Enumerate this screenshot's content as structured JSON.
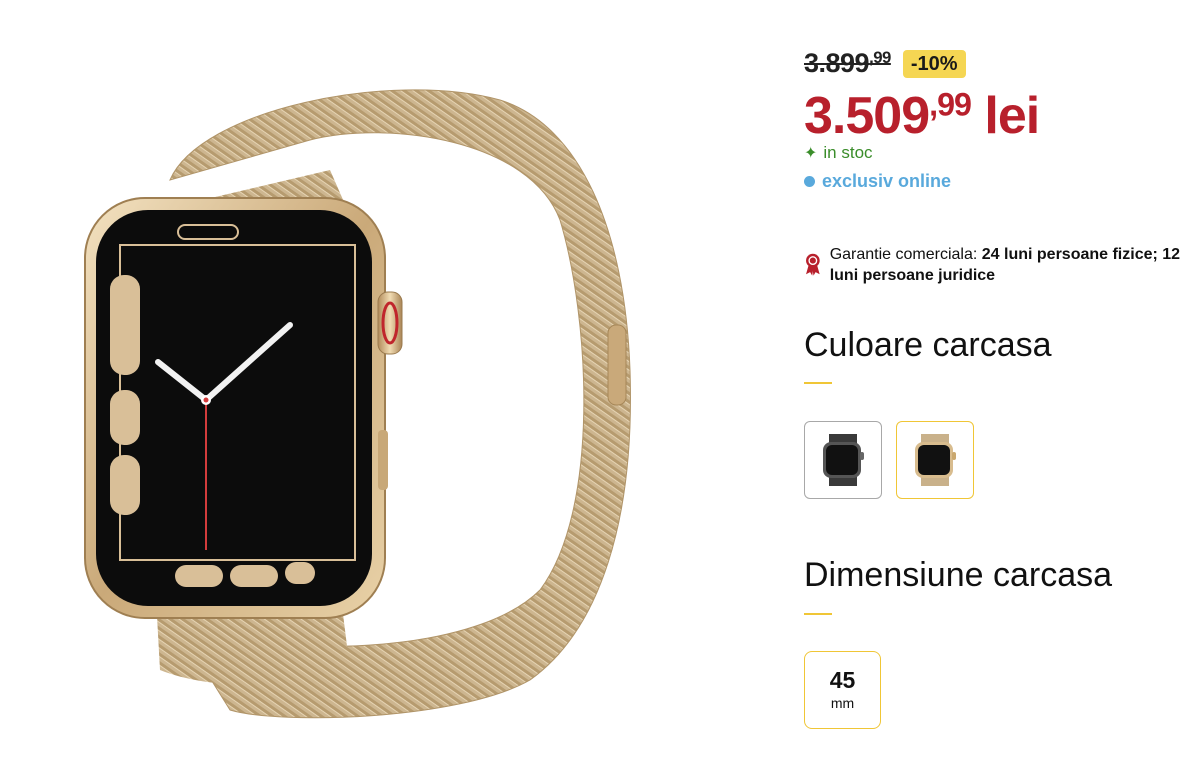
{
  "product": {
    "image_alt": "Apple Watch gold stainless steel case with gold milanese loop",
    "colors": {
      "accent": "#f0c636",
      "price_red": "#b8202c",
      "stock_green": "#3a8d2a",
      "online_blue": "#59a9dc"
    }
  },
  "price": {
    "old_int": "3.899",
    "old_dec": ",99",
    "discount": "-10%",
    "new_int": "3.509",
    "new_dec": ",99",
    "currency": " lei"
  },
  "availability": {
    "stock": "in stoc",
    "online": "exclusiv online"
  },
  "warranty": {
    "prefix": "Garantie comerciala: ",
    "bold": "24 luni persoane fizice; 12 luni persoane juridice",
    "icon": "ribbon-icon"
  },
  "case_color": {
    "title": "Culoare carcasa",
    "options": [
      {
        "name": "graphite",
        "selected": false
      },
      {
        "name": "gold",
        "selected": true
      }
    ]
  },
  "case_size": {
    "title": "Dimensiune carcasa",
    "value": "45",
    "unit": "mm"
  }
}
